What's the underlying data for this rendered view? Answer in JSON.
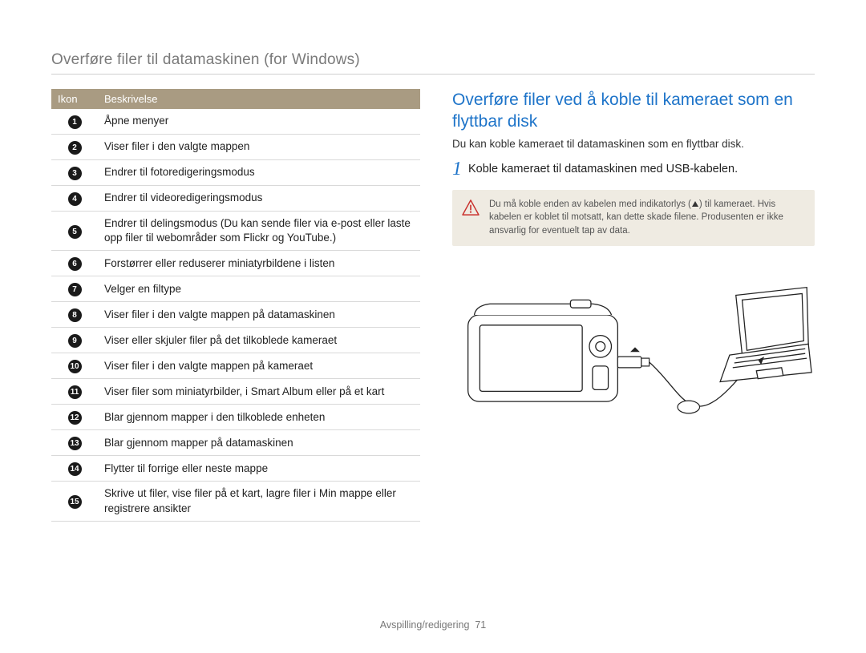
{
  "page_title": "Overføre filer til datamaskinen (for Windows)",
  "table": {
    "headers": {
      "icon": "Ikon",
      "desc": "Beskrivelse"
    },
    "rows": [
      {
        "num": "1",
        "desc": "Åpne menyer"
      },
      {
        "num": "2",
        "desc": "Viser filer i den valgte mappen"
      },
      {
        "num": "3",
        "desc": "Endrer til fotoredigeringsmodus"
      },
      {
        "num": "4",
        "desc": "Endrer til videoredigeringsmodus"
      },
      {
        "num": "5",
        "desc": "Endrer til delingsmodus (Du kan sende filer via e-post eller laste opp filer til webområder som Flickr og YouTube.)"
      },
      {
        "num": "6",
        "desc": "Forstørrer eller reduserer miniatyrbildene i listen"
      },
      {
        "num": "7",
        "desc": "Velger en filtype"
      },
      {
        "num": "8",
        "desc": "Viser filer i den valgte mappen på datamaskinen"
      },
      {
        "num": "9",
        "desc": "Viser eller skjuler filer på det tilkoblede kameraet"
      },
      {
        "num": "10",
        "desc": "Viser filer i den valgte mappen på kameraet"
      },
      {
        "num": "11",
        "desc": "Viser filer som miniatyrbilder, i Smart Album eller på et kart"
      },
      {
        "num": "12",
        "desc": "Blar gjennom mapper i den tilkoblede enheten"
      },
      {
        "num": "13",
        "desc": "Blar gjennom mapper på datamaskinen"
      },
      {
        "num": "14",
        "desc": "Flytter til forrige eller neste mappe"
      },
      {
        "num": "15",
        "desc": "Skrive ut filer, vise filer på et kart, lagre filer i Min mappe eller registrere ansikter"
      }
    ]
  },
  "right": {
    "heading": "Overføre filer ved å koble til kameraet som en flyttbar disk",
    "subtext": "Du kan koble kameraet til datamaskinen som en flyttbar disk.",
    "step1_num": "1",
    "step1_text": "Koble kameraet til datamaskinen med USB-kabelen.",
    "warn_pre": "Du må koble enden av kabelen med indikatorlys (",
    "warn_post": ") til kameraet. Hvis kabelen er koblet til motsatt, kan dette skade filene. Produsenten er ikke ansvarlig for eventuelt tap av data."
  },
  "footer": {
    "section": "Avspilling/redigering",
    "page": "71"
  }
}
